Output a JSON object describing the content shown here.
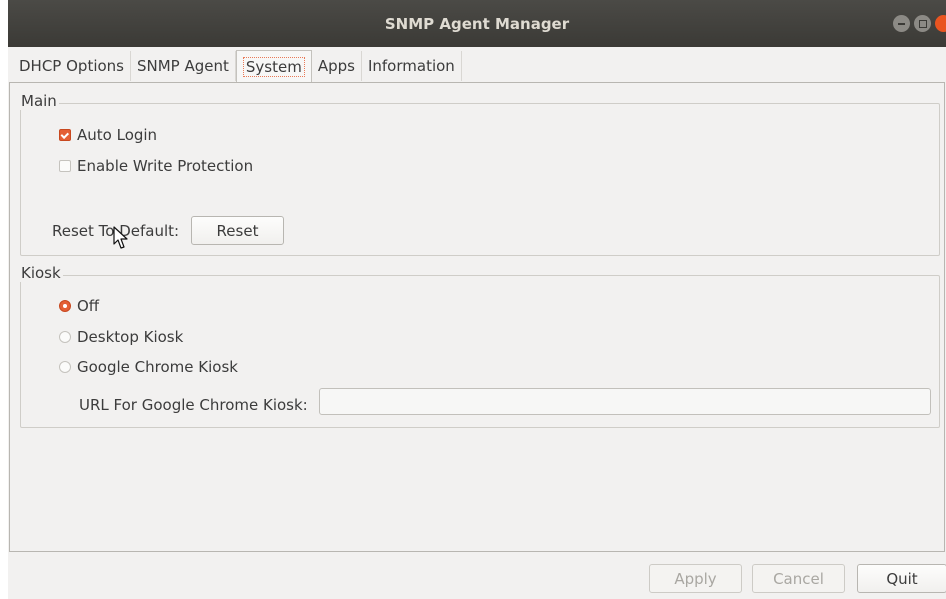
{
  "window": {
    "title": "SNMP Agent Manager"
  },
  "tabs": [
    {
      "label": "DHCP Options"
    },
    {
      "label": "SNMP Agent"
    },
    {
      "label": "System",
      "active": true
    },
    {
      "label": "Apps"
    },
    {
      "label": "Information"
    }
  ],
  "main": {
    "legend": "Main",
    "auto_login": {
      "label": "Auto Login",
      "checked": true
    },
    "write_protection": {
      "label": "Enable Write Protection",
      "checked": false
    },
    "reset_label": "Reset To Default:",
    "reset_button": "Reset"
  },
  "kiosk": {
    "legend": "Kiosk",
    "options": [
      {
        "label": "Off",
        "selected": true
      },
      {
        "label": "Desktop Kiosk",
        "selected": false
      },
      {
        "label": "Google Chrome Kiosk",
        "selected": false
      }
    ],
    "url_label": "URL For Google Chrome Kiosk:",
    "url_value": ""
  },
  "footer": {
    "apply": "Apply",
    "cancel": "Cancel",
    "quit": "Quit"
  },
  "colors": {
    "accent": "#e45f35",
    "titlebar": "#3b3a36"
  },
  "icons": [
    "minimize-icon",
    "maximize-icon",
    "close-icon",
    "mouse-pointer-icon"
  ]
}
